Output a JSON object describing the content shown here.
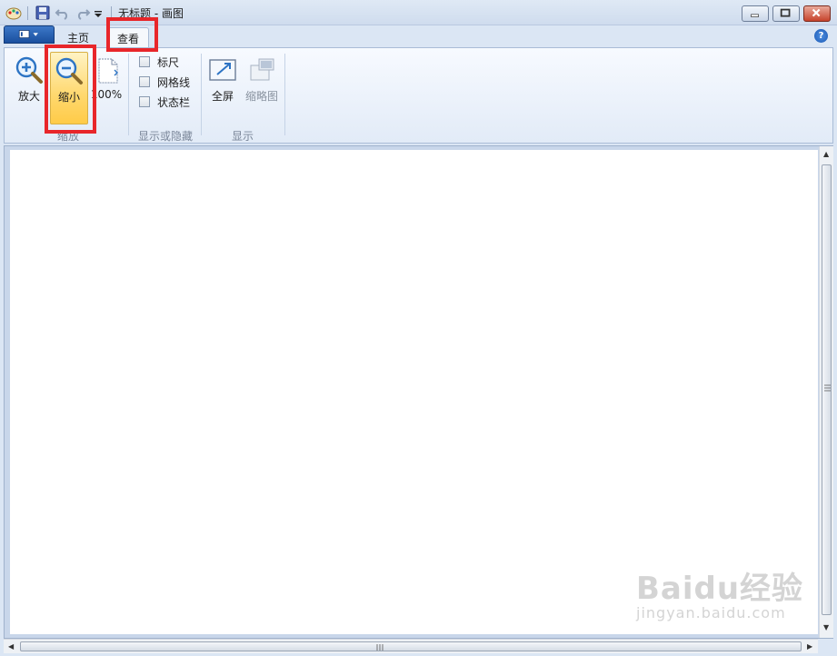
{
  "window": {
    "title": "无标题 - 画图"
  },
  "tabs": [
    {
      "label": "主页",
      "active": false
    },
    {
      "label": "查看",
      "active": true
    }
  ],
  "ribbon": {
    "zoom_group": {
      "label": "缩放",
      "zoom_in": "放大",
      "zoom_out": "缩小",
      "actual_size": "100%"
    },
    "show_hide_group": {
      "label": "显示或隐藏",
      "ruler": {
        "label": "标尺",
        "checked": false
      },
      "gridlines": {
        "label": "网格线",
        "checked": false
      },
      "statusbar": {
        "label": "状态栏",
        "checked": false
      }
    },
    "display_group": {
      "label": "显示",
      "fullscreen": "全屏",
      "thumbnail": "缩略图"
    }
  },
  "help": {
    "label": "?"
  },
  "watermark": {
    "main": "Baidu经验",
    "sub": "jingyan.baidu.com"
  },
  "colors": {
    "highlight_red": "#e8262a",
    "hot_button": "#ffd86e",
    "file_button": "#1a4f9e"
  }
}
